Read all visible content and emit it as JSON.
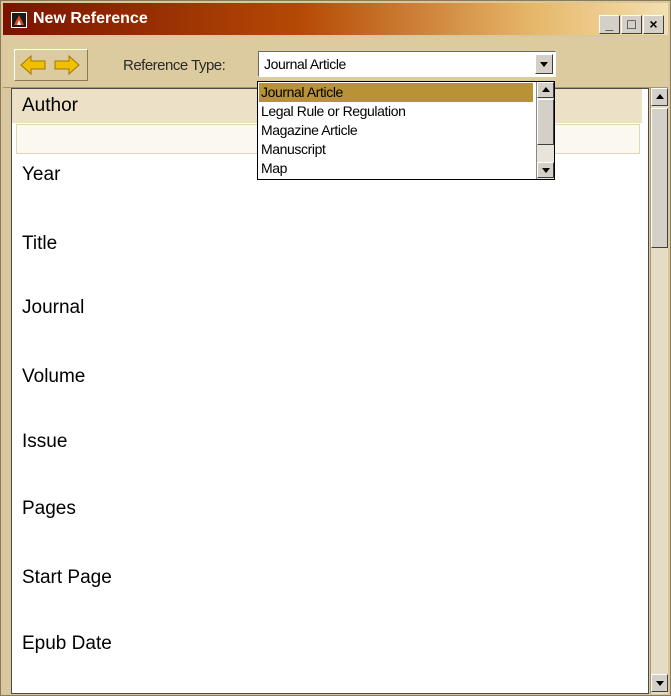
{
  "window": {
    "title": "New Reference",
    "controls": {
      "minimize": "_",
      "maximize": "□",
      "close": "×"
    }
  },
  "toolbar": {
    "back_icon": "left-arrow-icon",
    "forward_icon": "right-arrow-icon",
    "reference_type_label": "Reference Type:",
    "reference_type_value": "Journal Article"
  },
  "dropdown": {
    "options": [
      "Journal Article",
      "Legal Rule or Regulation",
      "Magazine Article",
      "Manuscript",
      "Map"
    ],
    "selected": "Journal Article"
  },
  "fields": [
    "Author",
    "Year",
    "Title",
    "Journal",
    "Volume",
    "Issue",
    "Pages",
    "Start Page",
    "Epub Date"
  ],
  "colors": {
    "title_gradient_start": "#7a1300",
    "title_gradient_end": "#f3dfb1",
    "selection": "#b89234",
    "arrow": "#f0c000",
    "panel": "#dccb9f"
  }
}
